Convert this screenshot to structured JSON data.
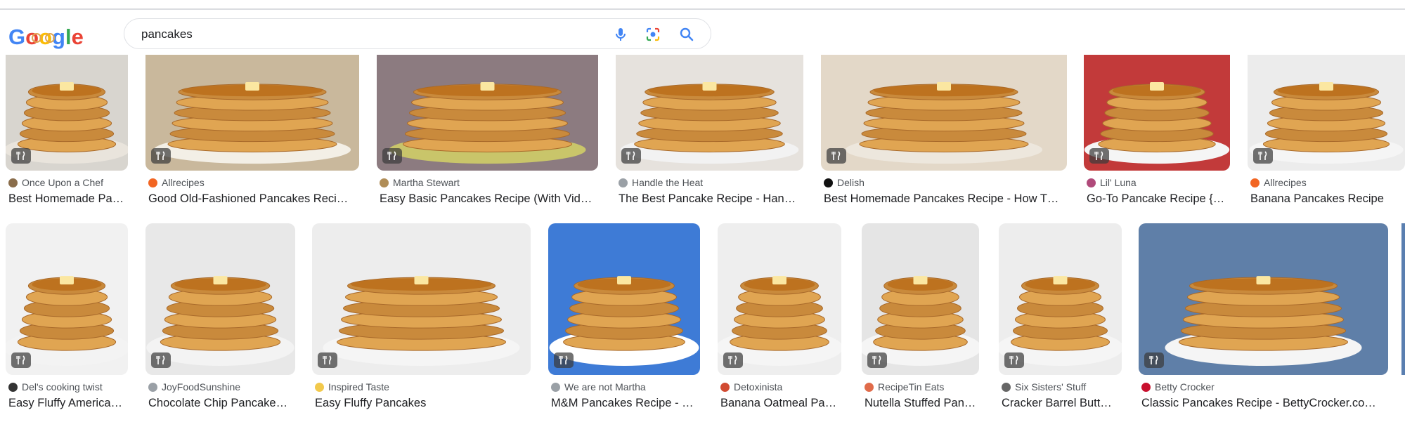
{
  "header": {
    "logo_text": "Google",
    "search": {
      "value": "pancakes"
    },
    "icons": [
      "mic-icon",
      "lens-icon",
      "search-icon"
    ]
  },
  "colors": {
    "google_blue": "#4285F4",
    "google_red": "#EA4335",
    "google_yellow": "#FBBC05",
    "google_green": "#34A853",
    "pancake": "#e0a552",
    "syrup": "#b86a16"
  },
  "row1": [
    {
      "source": "Once Upon a Chef",
      "title": "Best Homemade Pa…",
      "favicon": "#8a6d4b",
      "plate": "#e9e4dc",
      "bg": "#d8d5cf"
    },
    {
      "source": "Allrecipes",
      "title": "Good Old-Fashioned Pancakes Reci…",
      "favicon": "#f26522",
      "plate": "#f3efe6",
      "bg": "#c9b89c"
    },
    {
      "source": "Martha Stewart",
      "title": "Easy Basic Pancakes Recipe (With Vid…",
      "favicon": "#b08d57",
      "plate": "#c9c56a",
      "bg": "#8c7b80"
    },
    {
      "source": "Handle the Heat",
      "title": "The Best Pancake Recipe - Han…",
      "favicon": "#9aa0a6",
      "plate": "#f2f2f2",
      "bg": "#e6e2dd"
    },
    {
      "source": "Delish",
      "title": "Best Homemade Pancakes Recipe - How T…",
      "favicon": "#111111",
      "plate": "#ede7dd",
      "bg": "#e3d8c8"
    },
    {
      "source": "Lil' Luna",
      "title": "Go-To Pancake Recipe {…",
      "favicon": "#b04a7a",
      "plate": "#f5f5f5",
      "bg": "#c23a3a"
    },
    {
      "source": "Allrecipes",
      "title": "Banana Pancakes Recipe",
      "favicon": "#f26522",
      "plate": "#f5f5f5",
      "bg": "#ececec"
    }
  ],
  "row2": [
    {
      "source": "Del's cooking twist",
      "title": "Easy Fluffy America…",
      "favicon": "#333333",
      "plate": "#f3f3f3",
      "bg": "#f1f1f1"
    },
    {
      "source": "JoyFoodSunshine",
      "title": "Chocolate Chip Pancake…",
      "favicon": "#9aa0a6",
      "plate": "#f3f3f3",
      "bg": "#e8e8e8"
    },
    {
      "source": "Inspired Taste",
      "title": "Easy Fluffy Pancakes",
      "favicon": "#f2c94c",
      "plate": "#f5f5f5",
      "bg": "#ededed"
    },
    {
      "source": "We are not Martha",
      "title": "M&M Pancakes Recipe - …",
      "favicon": "#9aa0a6",
      "plate": "#ffffff",
      "bg": "#3e7bd6"
    },
    {
      "source": "Detoxinista",
      "title": "Banana Oatmeal Pa…",
      "favicon": "#d14b32",
      "plate": "#f5f5f5",
      "bg": "#eeeeee"
    },
    {
      "source": "RecipeTin Eats",
      "title": "Nutella Stuffed Pan…",
      "favicon": "#e06b4a",
      "plate": "#f5f5f5",
      "bg": "#e5e5e5"
    },
    {
      "source": "Six Sisters' Stuff",
      "title": "Cracker Barrel Butt…",
      "favicon": "#666666",
      "plate": "#f5f5f5",
      "bg": "#ededed"
    },
    {
      "source": "Betty Crocker",
      "title": "Classic Pancakes Recipe - BettyCrocker.co…",
      "favicon": "#c8102e",
      "plate": "#f5f5f5",
      "bg": "#5f7fa8"
    }
  ]
}
